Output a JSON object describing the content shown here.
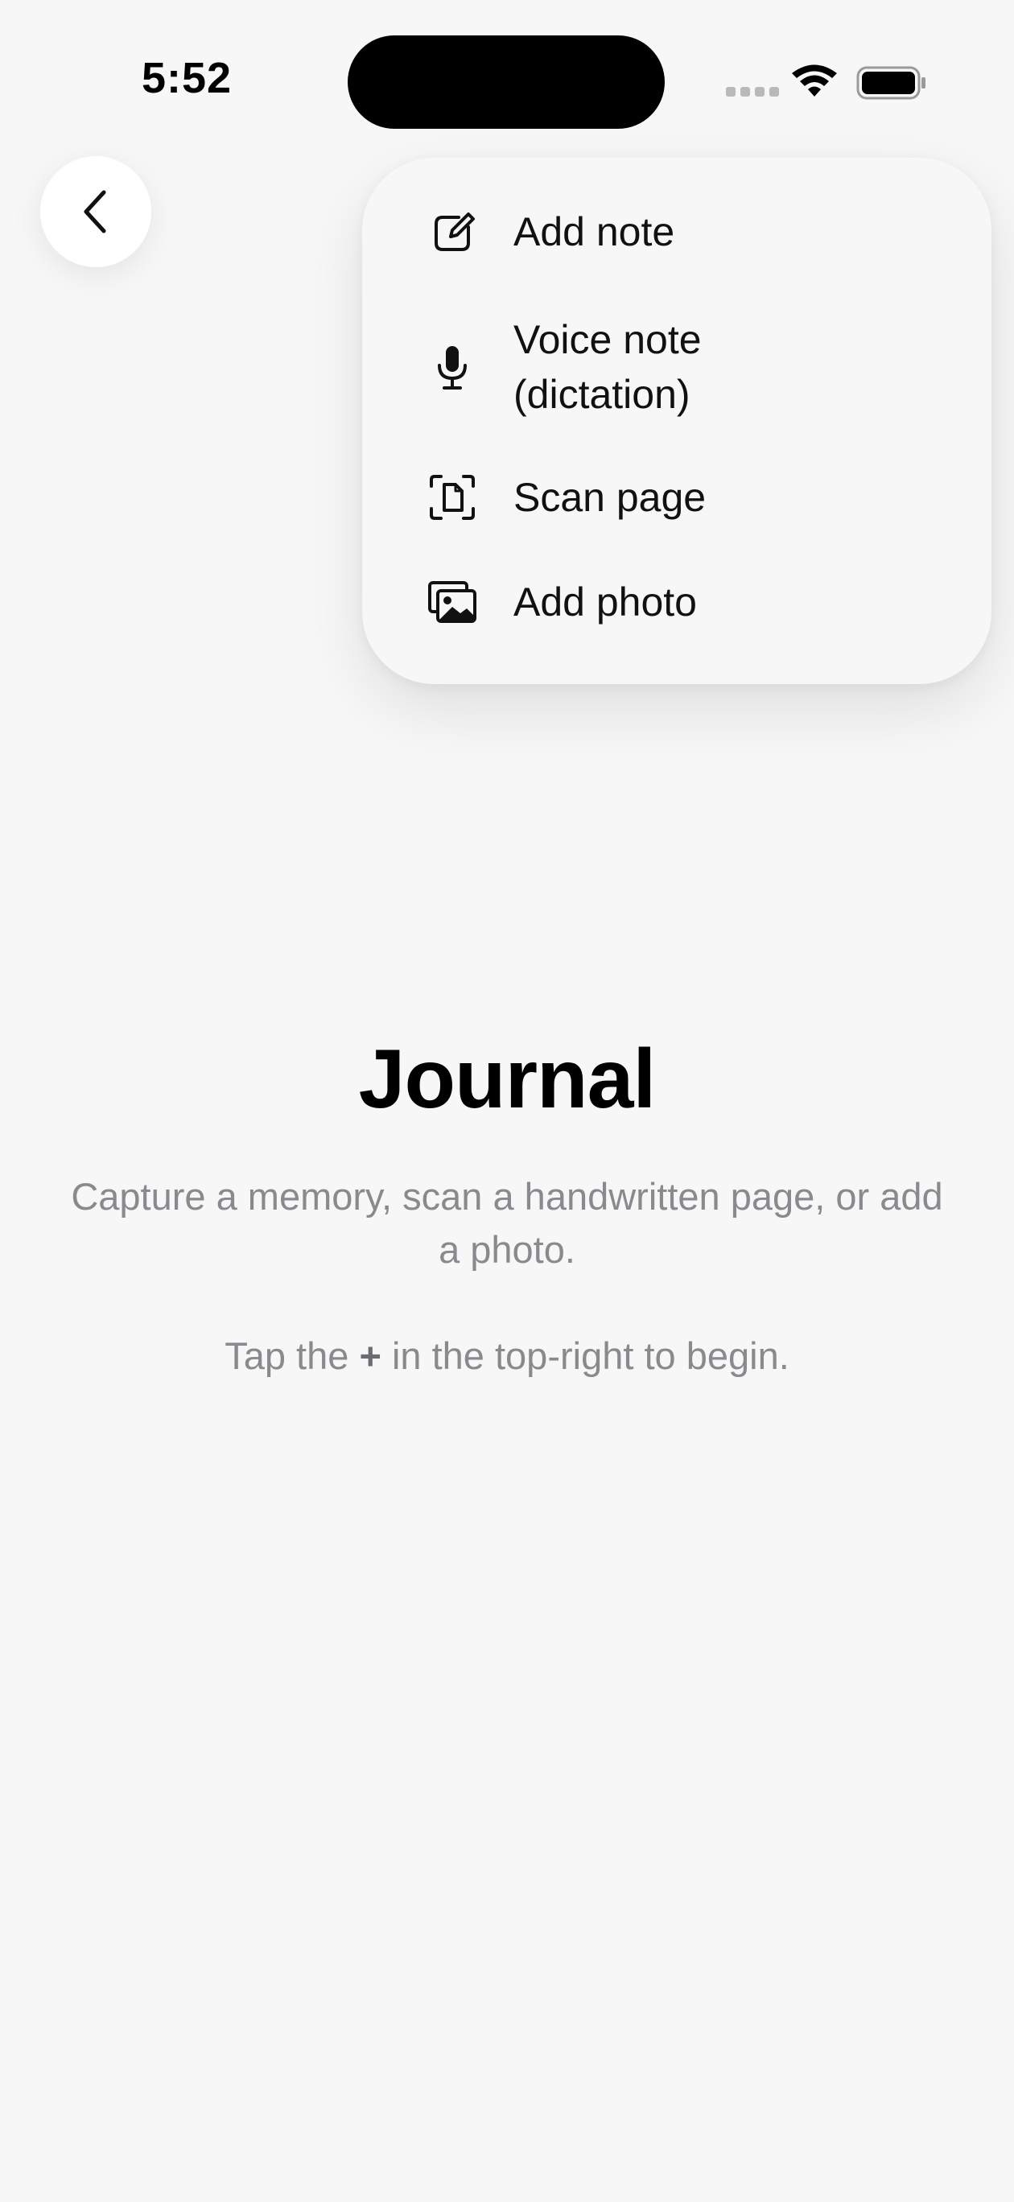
{
  "status_bar": {
    "time": "5:52",
    "icons": [
      "signal-dots-icon",
      "wifi-icon",
      "battery-icon"
    ]
  },
  "nav": {
    "back_icon": "chevron-left-icon"
  },
  "menu": {
    "items": [
      {
        "label": "Add note",
        "icon": "square-pencil-icon"
      },
      {
        "label": "Voice note\n(dictation)",
        "icon": "microphone-icon"
      },
      {
        "label": "Scan page",
        "icon": "document-scan-icon"
      },
      {
        "label": "Add photo",
        "icon": "photos-icon"
      }
    ]
  },
  "content": {
    "title": "Journal",
    "subtitle": "Capture a memory, scan a handwritten page, or add a photo.",
    "hint_before": "Tap the ",
    "hint_plus": "+",
    "hint_after": " in the top-right to begin."
  },
  "colors": {
    "background": "#f7f7f7",
    "secondary_text": "#8a8a8e",
    "primary_text": "#000000"
  }
}
